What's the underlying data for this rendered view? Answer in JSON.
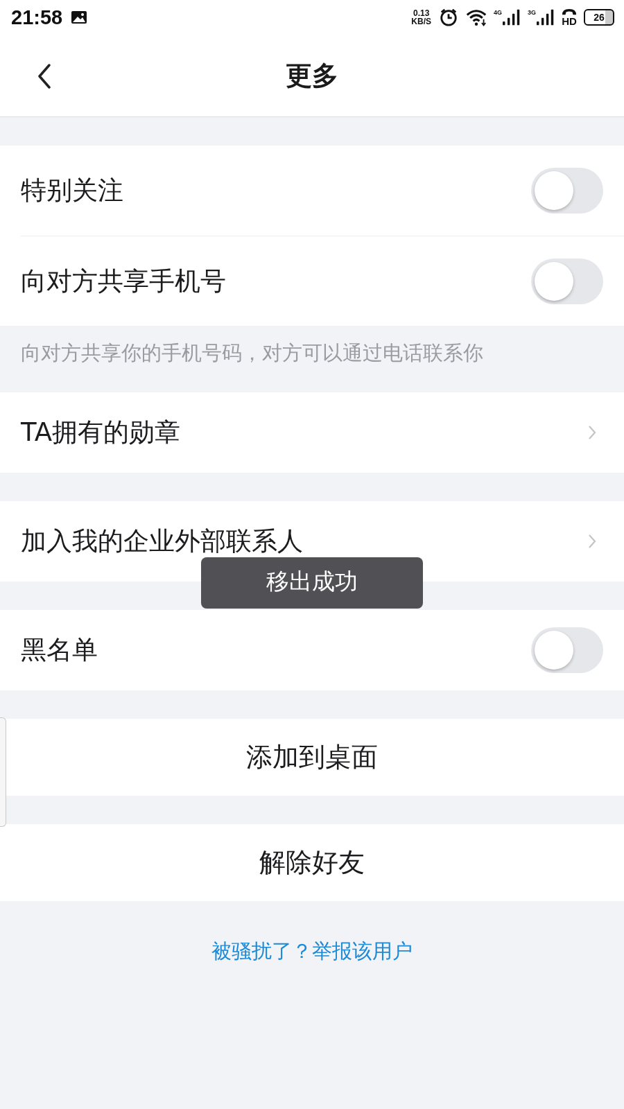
{
  "status_bar": {
    "time": "21:58",
    "speed_value": "0.13",
    "speed_unit": "KB/S",
    "signal_1": "4G",
    "signal_2": "3G",
    "call_label": "HD",
    "battery": "26"
  },
  "nav": {
    "title": "更多"
  },
  "sections": [
    {
      "rows": [
        {
          "kind": "toggle",
          "label": "特别关注",
          "on": false
        },
        {
          "kind": "toggle",
          "label": "向对方共享手机号",
          "on": false
        }
      ],
      "note": "向对方共享你的手机号码，对方可以通过电话联系你"
    },
    {
      "rows": [
        {
          "kind": "link",
          "label": "TA拥有的勋章"
        }
      ]
    },
    {
      "rows": [
        {
          "kind": "link",
          "label": "加入我的企业外部联系人"
        }
      ]
    },
    {
      "rows": [
        {
          "kind": "toggle",
          "label": "黑名单",
          "on": false
        }
      ]
    },
    {
      "rows": [
        {
          "kind": "action",
          "label": "添加到桌面"
        }
      ]
    },
    {
      "rows": [
        {
          "kind": "action",
          "label": "解除好友"
        }
      ]
    }
  ],
  "report_link": "被骚扰了？举报该用户",
  "toast": "移出成功"
}
